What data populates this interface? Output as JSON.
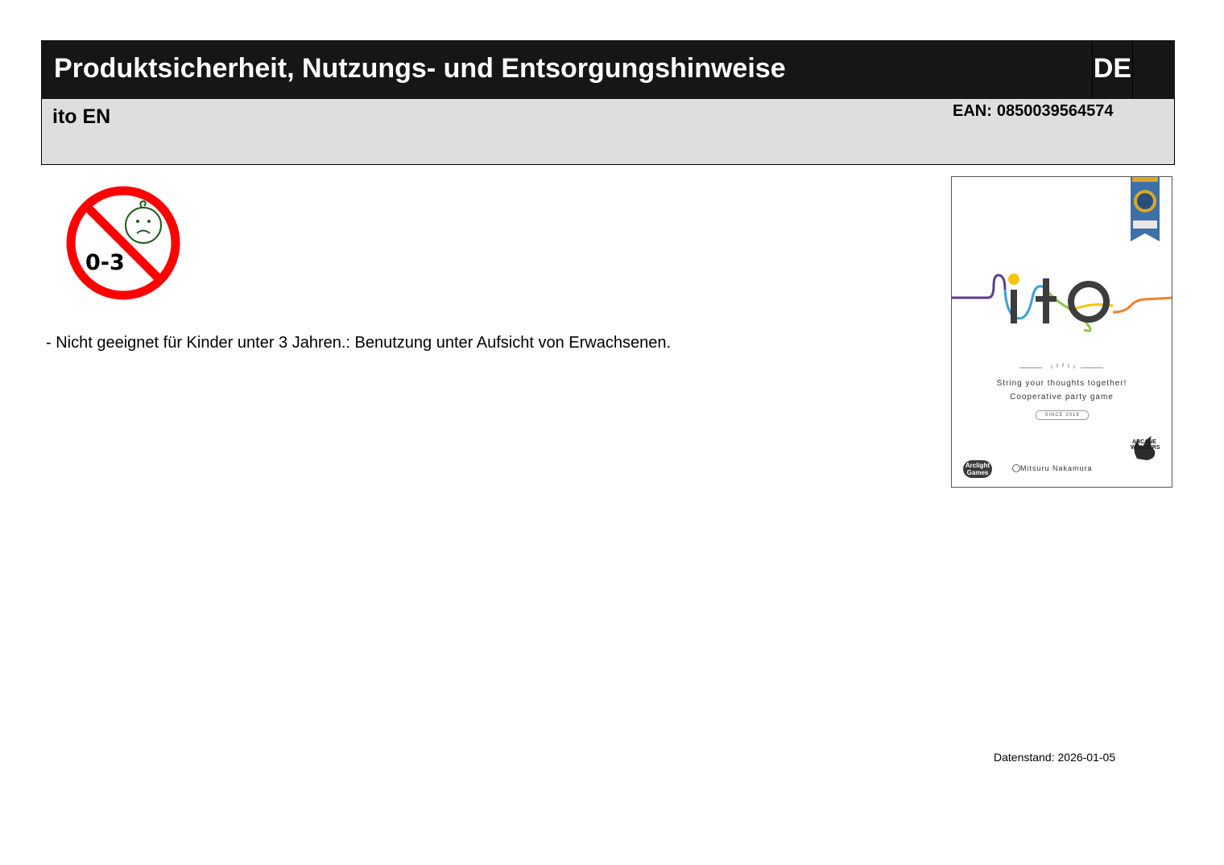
{
  "header": {
    "title": "Produktsicherheit, Nutzungs- und Entsorgungshinweise",
    "language": "DE"
  },
  "product": {
    "name": "ito EN",
    "ean_label": "EAN:",
    "ean_value": "0850039564574"
  },
  "age_warning_icon": {
    "label": "0-3",
    "icon": "no-children-under-3-icon",
    "color": "#ff0000"
  },
  "warning": {
    "text": "- Nicht geeignet für Kinder unter 3 Jahren.: Benutzung unter Aufsicht von Erwachsenen."
  },
  "cover_image": {
    "logo": "ito",
    "tagline_1": "String your thoughts together!",
    "tagline_2": "Cooperative party game",
    "since": "SINCE 2019",
    "author": "Mitsuru Nakamura",
    "publisher_left": "Arclight Games",
    "publisher_right": "ARCANE WONDERS",
    "ribbon_text": "BEST PARTY GAME"
  },
  "footer": {
    "date_label": "Datenstand:",
    "date_value": "2026-01-05"
  }
}
